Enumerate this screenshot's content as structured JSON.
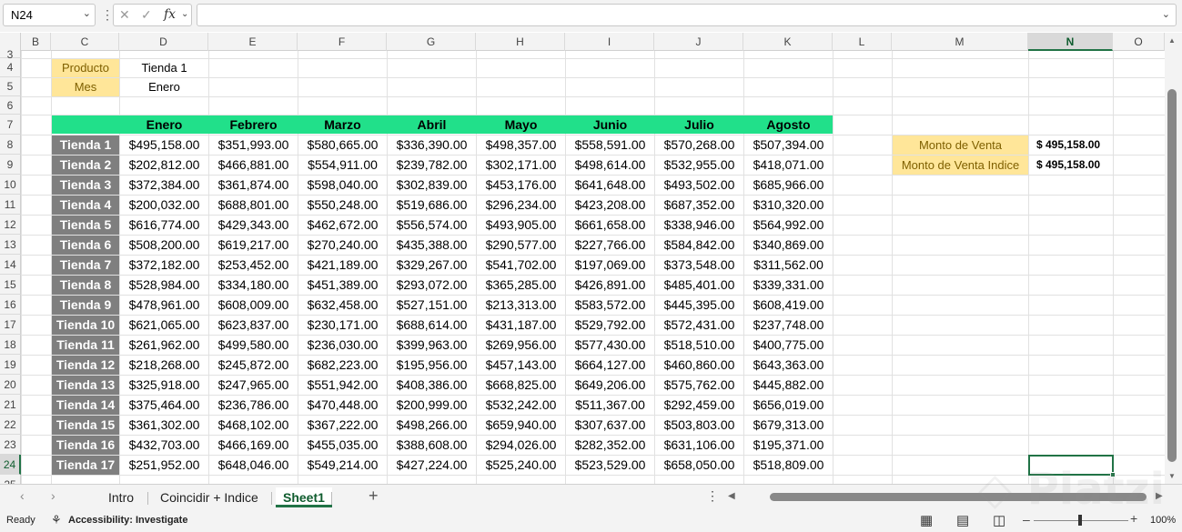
{
  "formula_bar": {
    "name_box": "N24",
    "formula": ""
  },
  "columns": [
    "B",
    "C",
    "D",
    "E",
    "F",
    "G",
    "H",
    "I",
    "J",
    "K",
    "L",
    "M",
    "N",
    "O"
  ],
  "rows": [
    "3",
    "4",
    "5",
    "6",
    "7",
    "8",
    "9",
    "10",
    "11",
    "12",
    "13",
    "14",
    "15",
    "16",
    "17",
    "18",
    "19",
    "20",
    "21",
    "22",
    "23",
    "24",
    "25"
  ],
  "inputs": {
    "producto_label": "Producto",
    "producto_value": "Tienda 1",
    "mes_label": "Mes",
    "mes_value": "Enero"
  },
  "table": {
    "months": [
      "Enero",
      "Febrero",
      "Marzo",
      "Abril",
      "Mayo",
      "Junio",
      "Julio",
      "Agosto"
    ],
    "rows": [
      {
        "store": "Tienda 1",
        "values": [
          "$495,158.00",
          "$351,993.00",
          "$580,665.00",
          "$336,390.00",
          "$498,357.00",
          "$558,591.00",
          "$570,268.00",
          "$507,394.00"
        ]
      },
      {
        "store": "Tienda 2",
        "values": [
          "$202,812.00",
          "$466,881.00",
          "$554,911.00",
          "$239,782.00",
          "$302,171.00",
          "$498,614.00",
          "$532,955.00",
          "$418,071.00"
        ]
      },
      {
        "store": "Tienda 3",
        "values": [
          "$372,384.00",
          "$361,874.00",
          "$598,040.00",
          "$302,839.00",
          "$453,176.00",
          "$641,648.00",
          "$493,502.00",
          "$685,966.00"
        ]
      },
      {
        "store": "Tienda 4",
        "values": [
          "$200,032.00",
          "$688,801.00",
          "$550,248.00",
          "$519,686.00",
          "$296,234.00",
          "$423,208.00",
          "$687,352.00",
          "$310,320.00"
        ]
      },
      {
        "store": "Tienda 5",
        "values": [
          "$616,774.00",
          "$429,343.00",
          "$462,672.00",
          "$556,574.00",
          "$493,905.00",
          "$661,658.00",
          "$338,946.00",
          "$564,992.00"
        ]
      },
      {
        "store": "Tienda 6",
        "values": [
          "$508,200.00",
          "$619,217.00",
          "$270,240.00",
          "$435,388.00",
          "$290,577.00",
          "$227,766.00",
          "$584,842.00",
          "$340,869.00"
        ]
      },
      {
        "store": "Tienda 7",
        "values": [
          "$372,182.00",
          "$253,452.00",
          "$421,189.00",
          "$329,267.00",
          "$541,702.00",
          "$197,069.00",
          "$373,548.00",
          "$311,562.00"
        ]
      },
      {
        "store": "Tienda 8",
        "values": [
          "$528,984.00",
          "$334,180.00",
          "$451,389.00",
          "$293,072.00",
          "$365,285.00",
          "$426,891.00",
          "$485,401.00",
          "$339,331.00"
        ]
      },
      {
        "store": "Tienda 9",
        "values": [
          "$478,961.00",
          "$608,009.00",
          "$632,458.00",
          "$527,151.00",
          "$213,313.00",
          "$583,572.00",
          "$445,395.00",
          "$608,419.00"
        ]
      },
      {
        "store": "Tienda 10",
        "values": [
          "$621,065.00",
          "$623,837.00",
          "$230,171.00",
          "$688,614.00",
          "$431,187.00",
          "$529,792.00",
          "$572,431.00",
          "$237,748.00"
        ]
      },
      {
        "store": "Tienda 11",
        "values": [
          "$261,962.00",
          "$499,580.00",
          "$236,030.00",
          "$399,963.00",
          "$269,956.00",
          "$577,430.00",
          "$518,510.00",
          "$400,775.00"
        ]
      },
      {
        "store": "Tienda 12",
        "values": [
          "$218,268.00",
          "$245,872.00",
          "$682,223.00",
          "$195,956.00",
          "$457,143.00",
          "$664,127.00",
          "$460,860.00",
          "$643,363.00"
        ]
      },
      {
        "store": "Tienda 13",
        "values": [
          "$325,918.00",
          "$247,965.00",
          "$551,942.00",
          "$408,386.00",
          "$668,825.00",
          "$649,206.00",
          "$575,762.00",
          "$445,882.00"
        ]
      },
      {
        "store": "Tienda 14",
        "values": [
          "$375,464.00",
          "$236,786.00",
          "$470,448.00",
          "$200,999.00",
          "$532,242.00",
          "$511,367.00",
          "$292,459.00",
          "$656,019.00"
        ]
      },
      {
        "store": "Tienda 15",
        "values": [
          "$361,302.00",
          "$468,102.00",
          "$367,222.00",
          "$498,266.00",
          "$659,940.00",
          "$307,637.00",
          "$503,803.00",
          "$679,313.00"
        ]
      },
      {
        "store": "Tienda 16",
        "values": [
          "$432,703.00",
          "$466,169.00",
          "$455,035.00",
          "$388,608.00",
          "$294,026.00",
          "$282,352.00",
          "$631,106.00",
          "$195,371.00"
        ]
      },
      {
        "store": "Tienda 17",
        "values": [
          "$251,952.00",
          "$648,046.00",
          "$549,214.00",
          "$427,224.00",
          "$525,240.00",
          "$523,529.00",
          "$658,050.00",
          "$518,809.00"
        ]
      }
    ]
  },
  "results": [
    {
      "label": "Monto de Venta",
      "value": "$  495,158.00"
    },
    {
      "label": "Monto de Venta Indice",
      "value": "$  495,158.00"
    }
  ],
  "sheet_tabs": [
    "Intro",
    "Coincidir + Indice",
    "Sheet1"
  ],
  "active_tab": "Sheet1",
  "status": {
    "ready": "Ready",
    "accessibility": "Accessibility: Investigate",
    "zoom": "100%"
  },
  "watermark": "Platzi",
  "colors": {
    "accent": "#217346",
    "header_green": "#21e08a",
    "store_gray": "#7f7f7f",
    "label_yellow": "#ffe699"
  }
}
